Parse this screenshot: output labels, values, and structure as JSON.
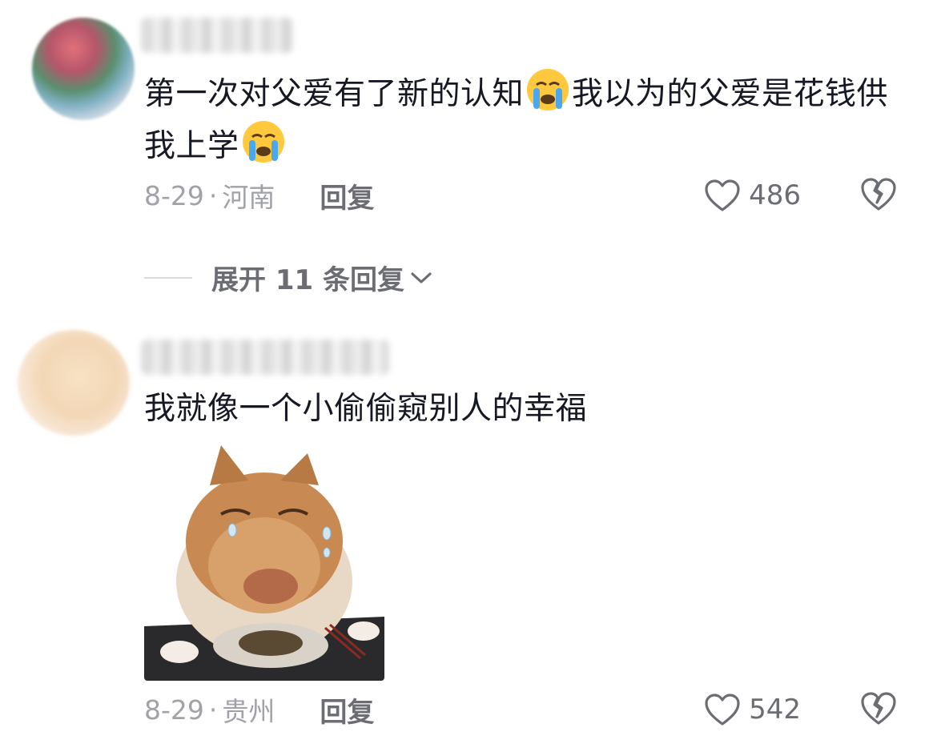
{
  "comments": [
    {
      "text_part1": "第一次对父爱有了新的认知",
      "text_part2": "我以为的父爱是花钱供我上学",
      "emoji": "loudly-crying-face",
      "date": "8-29",
      "location": "河南",
      "reply_label": "回复",
      "likes": "486"
    },
    {
      "text": "我就像一个小偷偷窥别人的幸福",
      "image": "crying-cat-with-food-bowl",
      "date": "8-29",
      "location": "贵州",
      "reply_label": "回复",
      "likes": "542"
    }
  ],
  "expand_replies_label": "展开 11 条回复",
  "separator": "·",
  "colors": {
    "text": "#161823",
    "meta": "#a0a2a8",
    "action": "#6b6d73"
  }
}
